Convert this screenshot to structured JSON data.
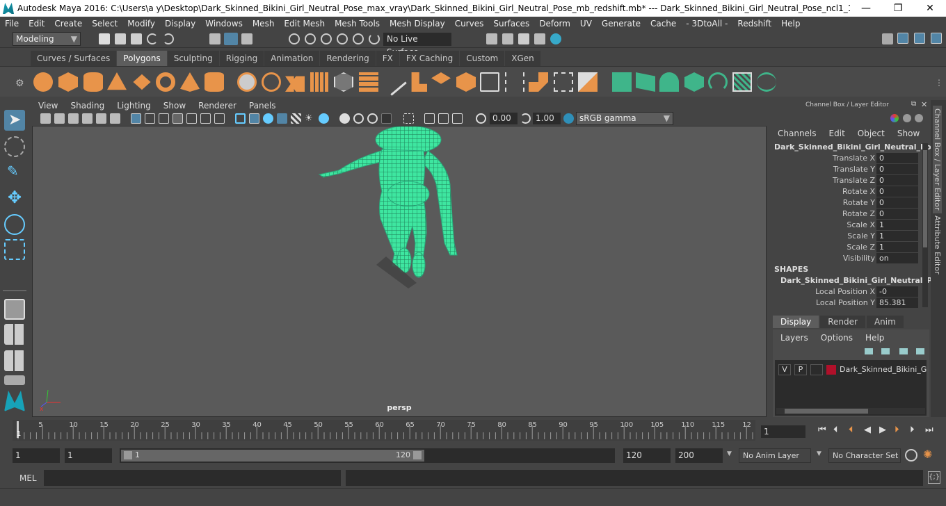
{
  "window": {
    "title": "Autodesk Maya 2016: C:\\Users\\a y\\Desktop\\Dark_Skinned_Bikini_Girl_Neutral_Pose_max_vray\\Dark_Skinned_Bikini_Girl_Neutral_Pose_mb_redshift.mb*   ---   Dark_Skinned_Bikini_Girl_Neutral_Pose_ncl1_1",
    "minimize": "—",
    "maximize": "❐",
    "close": "✕"
  },
  "menu": [
    "File",
    "Edit",
    "Create",
    "Select",
    "Modify",
    "Display",
    "Windows",
    "Mesh",
    "Edit Mesh",
    "Mesh Tools",
    "Mesh Display",
    "Curves",
    "Surfaces",
    "Deform",
    "UV",
    "Generate",
    "Cache",
    "- 3DtoAll -",
    "Redshift",
    "Help"
  ],
  "status": {
    "mode": "Modeling",
    "live_surface": "No Live Surface"
  },
  "shelf_tabs": [
    "Curves / Surfaces",
    "Polygons",
    "Sculpting",
    "Rigging",
    "Animation",
    "Rendering",
    "FX",
    "FX Caching",
    "Custom",
    "XGen"
  ],
  "shelf_active": "Polygons",
  "viewport": {
    "menu": [
      "View",
      "Shading",
      "Lighting",
      "Show",
      "Renderer",
      "Panels"
    ],
    "exposure": "0.00",
    "gamma": "1.00",
    "color_space": "sRGB gamma",
    "camera_label": "persp"
  },
  "channel_box": {
    "header": "Channel Box / Layer Editor",
    "menu": [
      "Channels",
      "Edit",
      "Object",
      "Show"
    ],
    "object_name": "Dark_Skinned_Bikini_Girl_Neutral_Pos...",
    "attributes": [
      {
        "label": "Translate X",
        "value": "0"
      },
      {
        "label": "Translate Y",
        "value": "0"
      },
      {
        "label": "Translate Z",
        "value": "0"
      },
      {
        "label": "Rotate X",
        "value": "0"
      },
      {
        "label": "Rotate Y",
        "value": "0"
      },
      {
        "label": "Rotate Z",
        "value": "0"
      },
      {
        "label": "Scale X",
        "value": "1"
      },
      {
        "label": "Scale Y",
        "value": "1"
      },
      {
        "label": "Scale Z",
        "value": "1"
      },
      {
        "label": "Visibility",
        "value": "on"
      }
    ],
    "shapes_header": "SHAPES",
    "shape_name": "Dark_Skinned_Bikini_Girl_Neutral_P...",
    "shape_attributes": [
      {
        "label": "Local Position X",
        "value": "-0"
      },
      {
        "label": "Local Position Y",
        "value": "85.381"
      }
    ]
  },
  "layer_editor": {
    "tabs": [
      "Display",
      "Render",
      "Anim"
    ],
    "menu": [
      "Layers",
      "Options",
      "Help"
    ],
    "layer": {
      "v": "V",
      "p": "P",
      "name": "Dark_Skinned_Bikini_Girl",
      "color": "#b0102a"
    }
  },
  "side_tabs": [
    "Channel Box / Layer Editor",
    "Attribute Editor"
  ],
  "timeline": {
    "ticks": [
      "5",
      "10",
      "15",
      "20",
      "25",
      "30",
      "35",
      "40",
      "45",
      "50",
      "55",
      "60",
      "65",
      "70",
      "75",
      "80",
      "85",
      "90",
      "95",
      "100",
      "105",
      "110",
      "115",
      "12"
    ],
    "start_marker": "1",
    "current_frame": "1"
  },
  "range": {
    "start": "1",
    "playback_start": "1",
    "slider_start": "1",
    "slider_end": "120",
    "playback_end": "120",
    "end": "200",
    "anim_layer": "No Anim Layer",
    "character_set": "No Character Set"
  },
  "command_line": {
    "label": "MEL"
  },
  "colors": {
    "accent": "#5285a6",
    "mesh": "#3ee6a0",
    "shelf_orange": "#e8944a",
    "shelf_green": "#3fb58a"
  }
}
